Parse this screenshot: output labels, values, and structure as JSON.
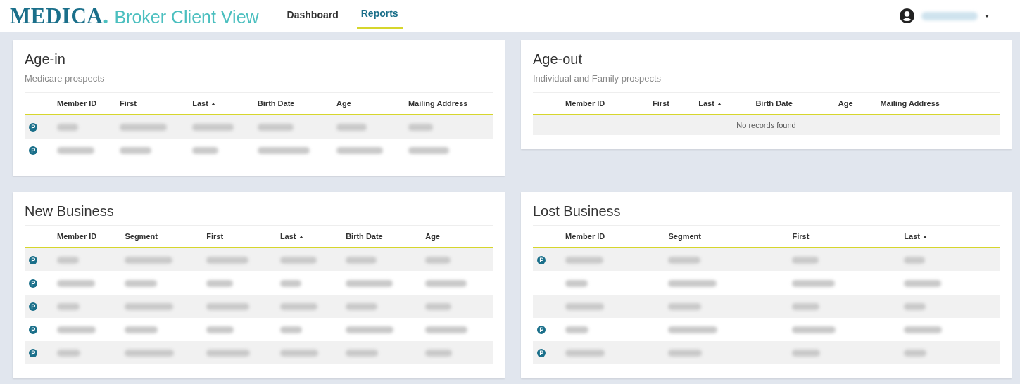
{
  "header": {
    "logo": "MEDICA",
    "logo_mark": ".",
    "app_title": "Broker Client View",
    "nav": [
      {
        "label": "Dashboard",
        "selected": false
      },
      {
        "label": "Reports",
        "selected": true
      }
    ]
  },
  "panels": [
    {
      "title": "Age-in",
      "subtitle": "Medicare prospects",
      "columns": [
        {
          "label": "Member ID",
          "sorted": false
        },
        {
          "label": "First",
          "sorted": false
        },
        {
          "label": "Last",
          "sorted": true
        },
        {
          "label": "Birth Date",
          "sorted": false
        },
        {
          "label": "Age",
          "sorted": false
        },
        {
          "label": "Mailing Address",
          "sorted": false
        }
      ],
      "rows": [
        {
          "badge": true
        },
        {
          "badge": true
        }
      ]
    },
    {
      "title": "Age-out",
      "subtitle": "Individual and Family prospects",
      "columns": [
        {
          "label": "Member ID",
          "sorted": false
        },
        {
          "label": "First",
          "sorted": false
        },
        {
          "label": "Last",
          "sorted": true
        },
        {
          "label": "Birth Date",
          "sorted": false
        },
        {
          "label": "Age",
          "sorted": false
        },
        {
          "label": "Mailing Address",
          "sorted": false
        }
      ],
      "empty_message": "No records found"
    },
    {
      "title": "New Business",
      "columns": [
        {
          "label": "Member ID",
          "sorted": false
        },
        {
          "label": "Segment",
          "sorted": false
        },
        {
          "label": "First",
          "sorted": false
        },
        {
          "label": "Last",
          "sorted": true
        },
        {
          "label": "Birth Date",
          "sorted": false
        },
        {
          "label": "Age",
          "sorted": false
        }
      ],
      "rows": [
        {
          "badge": true
        },
        {
          "badge": true
        },
        {
          "badge": true
        },
        {
          "badge": true
        },
        {
          "badge": true
        }
      ]
    },
    {
      "title": "Lost Business",
      "columns": [
        {
          "label": "Member ID",
          "sorted": false
        },
        {
          "label": "Segment",
          "sorted": false
        },
        {
          "label": "First",
          "sorted": false
        },
        {
          "label": "Last",
          "sorted": true
        }
      ],
      "rows": [
        {
          "badge": true
        },
        {
          "badge": false
        },
        {
          "badge": false
        },
        {
          "badge": true
        },
        {
          "badge": true
        }
      ]
    }
  ]
}
